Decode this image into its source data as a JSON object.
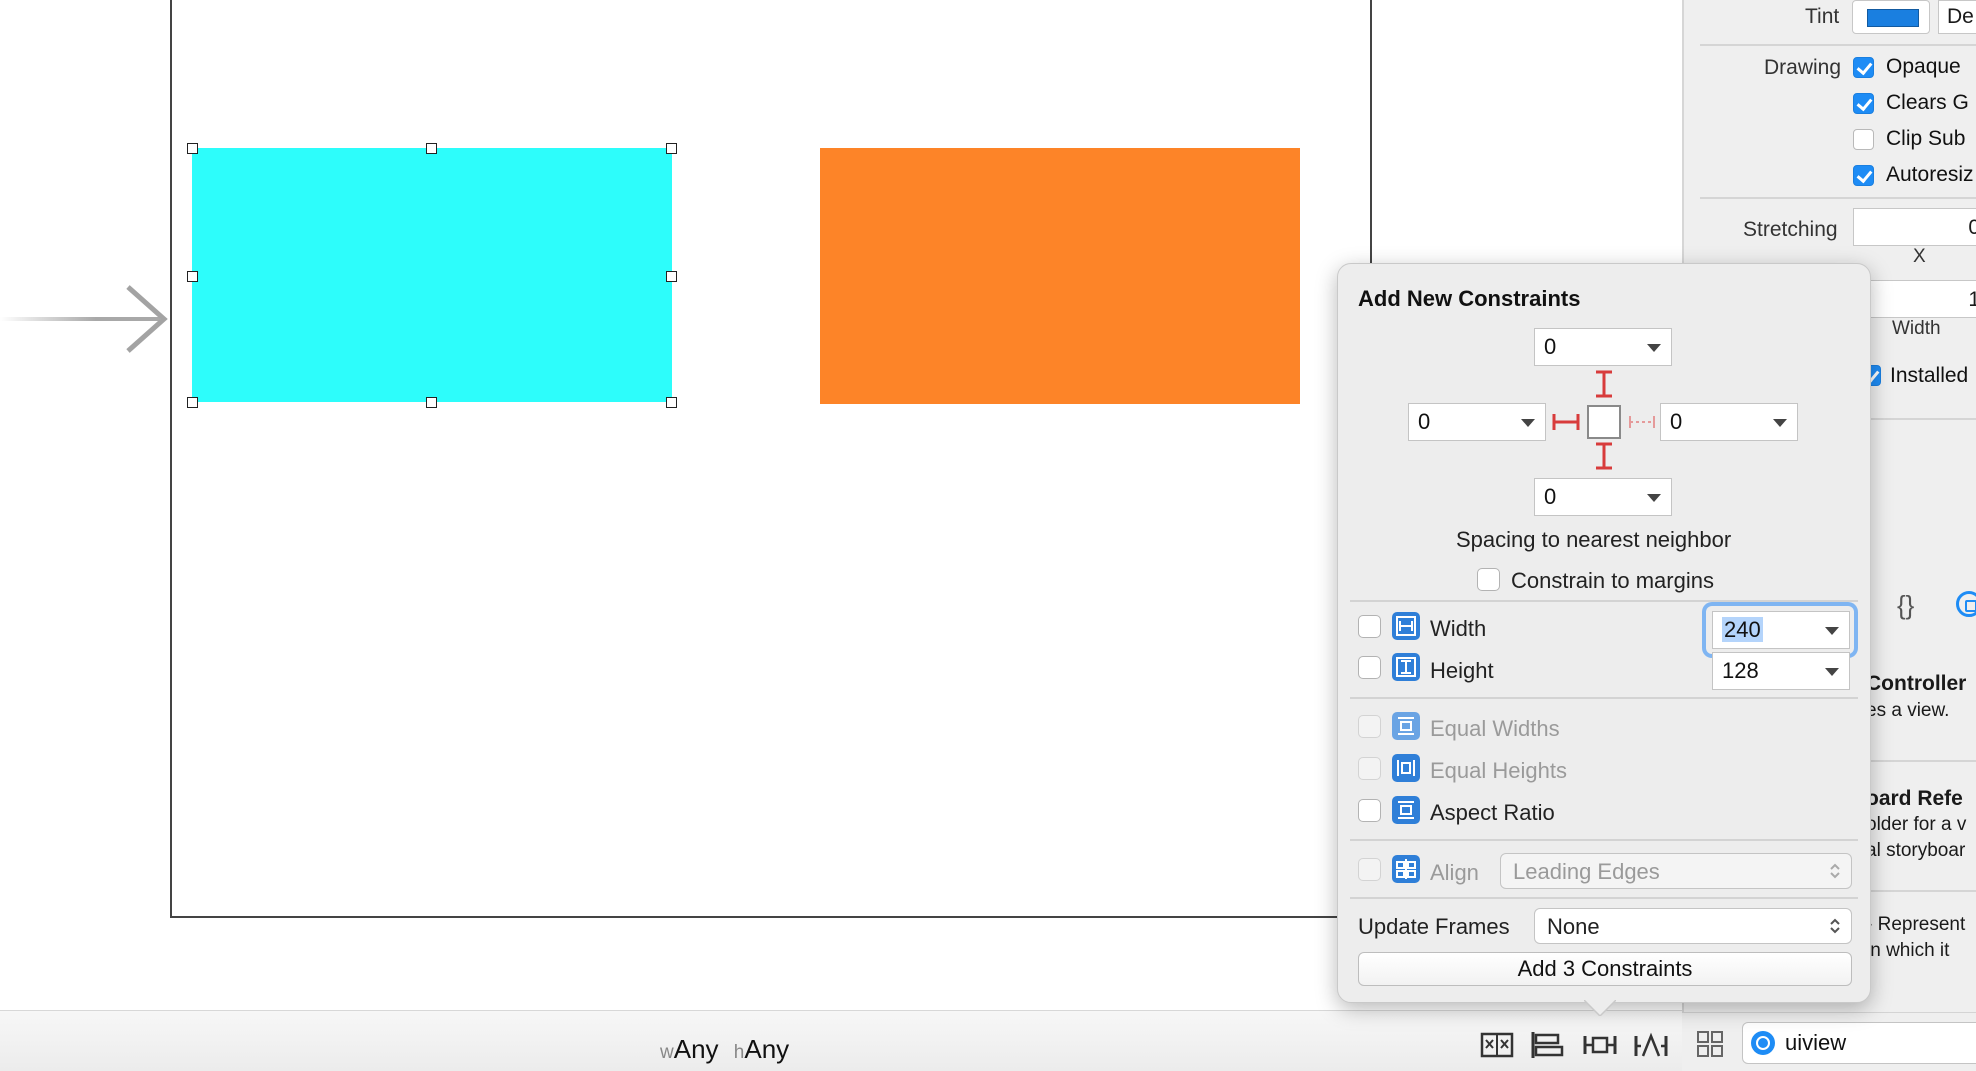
{
  "inspector": {
    "tint_label": "Tint",
    "tint_default": "De",
    "tint_color": "#1a7fe0",
    "drawing_label": "Drawing",
    "drawing_options": [
      {
        "label": "Opaque",
        "checked": true
      },
      {
        "label": "Clears G",
        "checked": true
      },
      {
        "label": "Clip Sub",
        "checked": false
      },
      {
        "label": "Autoresiz",
        "checked": true
      }
    ],
    "stretching_label": "Stretching",
    "stretching_value": "0",
    "x_label": "X",
    "width_value": "1",
    "width_label": "Width",
    "installed_label": "Installed",
    "library_items": [
      {
        "title": "Controller",
        "desc": "es a view."
      },
      {
        "title": "oard Refe",
        "desc": "older for a v",
        "desc2": "al storyboar"
      },
      {
        "title": "",
        "desc": "- Represent",
        "desc2": "in which it"
      }
    ],
    "braces_label": "{}",
    "search_value": "uiview"
  },
  "popover": {
    "title": "Add New Constraints",
    "spacing": {
      "top": "0",
      "left": "0",
      "right": "0",
      "bottom": "0"
    },
    "spacing_caption": "Spacing to nearest neighbor",
    "constrain_margins_label": "Constrain to margins",
    "constrain_margins_checked": false,
    "width": {
      "label": "Width",
      "value": "240",
      "checked": false
    },
    "height": {
      "label": "Height",
      "value": "128",
      "checked": false
    },
    "equal_widths_label": "Equal Widths",
    "equal_heights_label": "Equal Heights",
    "aspect_ratio_label": "Aspect Ratio",
    "align_label": "Align",
    "align_value": "Leading Edges",
    "update_frames_label": "Update Frames",
    "update_frames_value": "None",
    "add_button_label": "Add 3 Constraints"
  },
  "bottom_bar": {
    "w_prefix": "w",
    "w_value": "Any",
    "h_prefix": "h",
    "h_value": "Any"
  },
  "canvas": {
    "selected_view_color": "#2dfdfb",
    "other_view_color": "#fd8428"
  }
}
